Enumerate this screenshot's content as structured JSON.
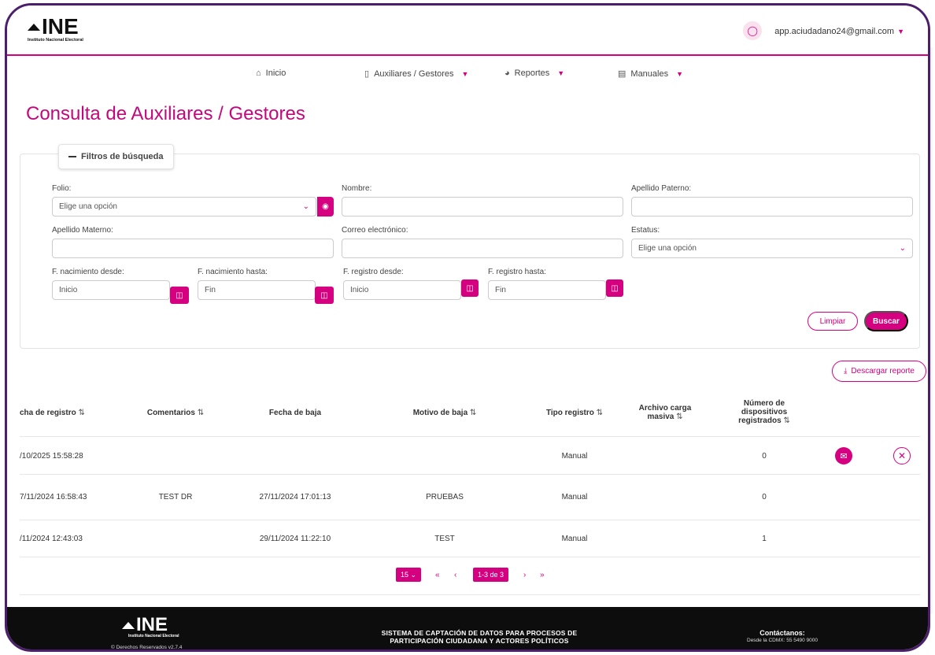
{
  "header": {
    "logo_text": "INE",
    "logo_sub": "Instituto Nacional Electoral",
    "user_email": "app.aciudadano24@gmail.com"
  },
  "nav": {
    "items": [
      {
        "label": "Inicio",
        "icon": "home-icon"
      },
      {
        "label": "Auxiliares / Gestores",
        "icon": "tablet-icon"
      },
      {
        "label": "Reportes",
        "icon": "chart-icon"
      },
      {
        "label": "Manuales",
        "icon": "document-icon"
      }
    ]
  },
  "page": {
    "title": "Consulta de Auxiliares / Gestores"
  },
  "filters": {
    "tab_label": "Filtros de búsqueda",
    "folio_label": "Folio:",
    "folio_value": "Elige una opción",
    "nombre_label": "Nombre:",
    "apellido_paterno_label": "Apellido Paterno:",
    "apellido_materno_label": "Apellido Materno:",
    "correo_label": "Correo electrónico:",
    "estatus_label": "Estatus:",
    "estatus_value": "Elige una opción",
    "f_nac_desde_label": "F. nacimiento desde:",
    "f_nac_desde_placeholder": "Inicio",
    "f_nac_hasta_label": "F. nacimiento hasta:",
    "f_nac_hasta_placeholder": "Fin",
    "f_reg_desde_label": "F. registro desde:",
    "f_reg_desde_placeholder": "Inicio",
    "f_reg_hasta_label": "F. registro hasta:",
    "f_reg_hasta_placeholder": "Fin",
    "limpiar_label": "Limpiar",
    "buscar_label": "Buscar"
  },
  "download_label": "Descargar reporte",
  "table": {
    "headers": {
      "fecha_registro": "cha de registro",
      "comentarios": "Comentarios",
      "fecha_baja": "Fecha de baja",
      "motivo_baja": "Motivo de baja",
      "tipo_registro": "Tipo registro",
      "archivo_l1": "Archivo carga",
      "archivo_l2": "masiva",
      "dispositivos_l1": "Número de",
      "dispositivos_l2": "dispositivos",
      "dispositivos_l3": "registrados"
    },
    "rows": [
      {
        "fecha_registro": "/10/2025 15:58:28",
        "comentarios": "",
        "fecha_baja": "",
        "motivo_baja": "",
        "tipo_registro": "Manual",
        "archivo": "",
        "dispositivos": "0"
      },
      {
        "fecha_registro": "7/11/2024 16:58:43",
        "comentarios": "TEST DR",
        "fecha_baja": "27/11/2024 17:01:13",
        "motivo_baja": "PRUEBAS",
        "tipo_registro": "Manual",
        "archivo": "",
        "dispositivos": "0"
      },
      {
        "fecha_registro": "/11/2024 12:43:03",
        "comentarios": "",
        "fecha_baja": "29/11/2024 11:22:10",
        "motivo_baja": "TEST",
        "tipo_registro": "Manual",
        "archivo": "",
        "dispositivos": "1"
      }
    ]
  },
  "pagination": {
    "page_size": "15",
    "range": "1-3 de 3"
  },
  "footer": {
    "logo_text": "INE",
    "logo_sub": "Instituto Nacional Electoral",
    "copyright": "© Derechos Reservados v2.7.4",
    "system_line1": "SISTEMA DE CAPTACIÓN DE DATOS PARA PROCESOS DE",
    "system_line2": "PARTICIPACIÓN CIUDADANA Y ACTORES POLÍTICOS",
    "contact_title": "Contáctanos:",
    "contact_phone": "Desde la CDMX: 55 5490 9000"
  },
  "colors": {
    "accent": "#d5007f",
    "frame": "#4b1f6b",
    "footer_bg": "#0d0d0d"
  }
}
